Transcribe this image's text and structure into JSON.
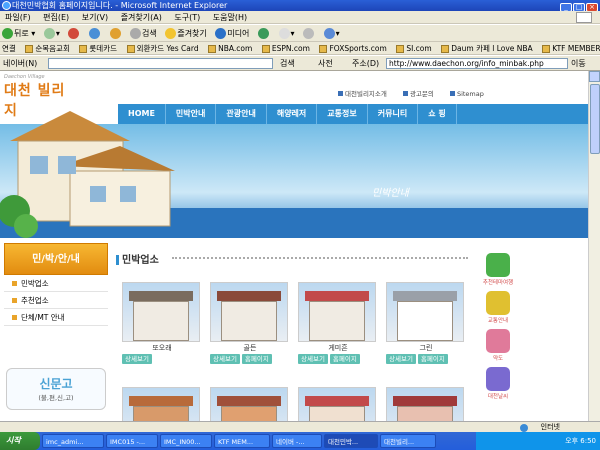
{
  "window": {
    "title": "대천민박협회 홈페이지입니다. - Microsoft Internet Explorer"
  },
  "menubar": {
    "items": [
      "파일(F)",
      "편집(E)",
      "보기(V)",
      "즐겨찾기(A)",
      "도구(T)",
      "도움말(H)"
    ]
  },
  "toolbar": {
    "back": "뒤로",
    "search": "검색",
    "favorites": "즐겨찾기",
    "media": "미디어"
  },
  "links": {
    "label": "연결",
    "items": [
      "순복음교회",
      "롯데카드",
      "외환카드 Yes Card",
      "NBA.com",
      "ESPN.com",
      "FOXSports.com",
      "SI.com",
      "Daum 카페 l Love NBA",
      "KTF MEMBERS"
    ]
  },
  "addressbar": {
    "naver_label": "네이버(N)",
    "search_label": "검색",
    "dict_label": "사전",
    "address_label": "주소(D)",
    "url": "http://www.daechon.org/info_minbak.php",
    "go_label": "이동"
  },
  "site": {
    "slogan": "Daechon Village",
    "logo": "대천 빌리지",
    "toplinks": [
      "대천빌리지소개",
      "광고문의",
      "Sitemap"
    ],
    "nav": [
      "HOME",
      "민박안내",
      "관광안내",
      "해양레저",
      "교통정보",
      "커뮤니티",
      "쇼 핑"
    ],
    "hero_caption": "민박안내",
    "sidebar": {
      "title": "민/박/안/내",
      "items": [
        "민박업소",
        "추천업소",
        "단체/MT 안내"
      ]
    },
    "notice": {
      "title": "신문고",
      "subtitle": "(불,편,신,고)"
    },
    "content_title": "민박업소",
    "cards": [
      {
        "name": "또오래",
        "buttons": [
          "상세보기"
        ]
      },
      {
        "name": "골든",
        "buttons": [
          "상세보기",
          "홈페이지"
        ]
      },
      {
        "name": "게미흔",
        "buttons": [
          "상세보기",
          "홈페이지"
        ]
      },
      {
        "name": "그린",
        "buttons": [
          "상세보기",
          "홈페이지"
        ]
      }
    ],
    "rightbar": [
      "추천테마여행",
      "교통안내",
      "약도",
      "대천날씨"
    ]
  },
  "statusbar": {
    "zone": "인터넷"
  },
  "taskbar": {
    "start": "시작",
    "tasks": [
      "imc_admi...",
      "IMC015 -...",
      "IMC_IN00...",
      "KTF MEM...",
      "네이버 -...",
      "대천민박...",
      "대천빌리..."
    ],
    "clock": "오후 6:50"
  }
}
